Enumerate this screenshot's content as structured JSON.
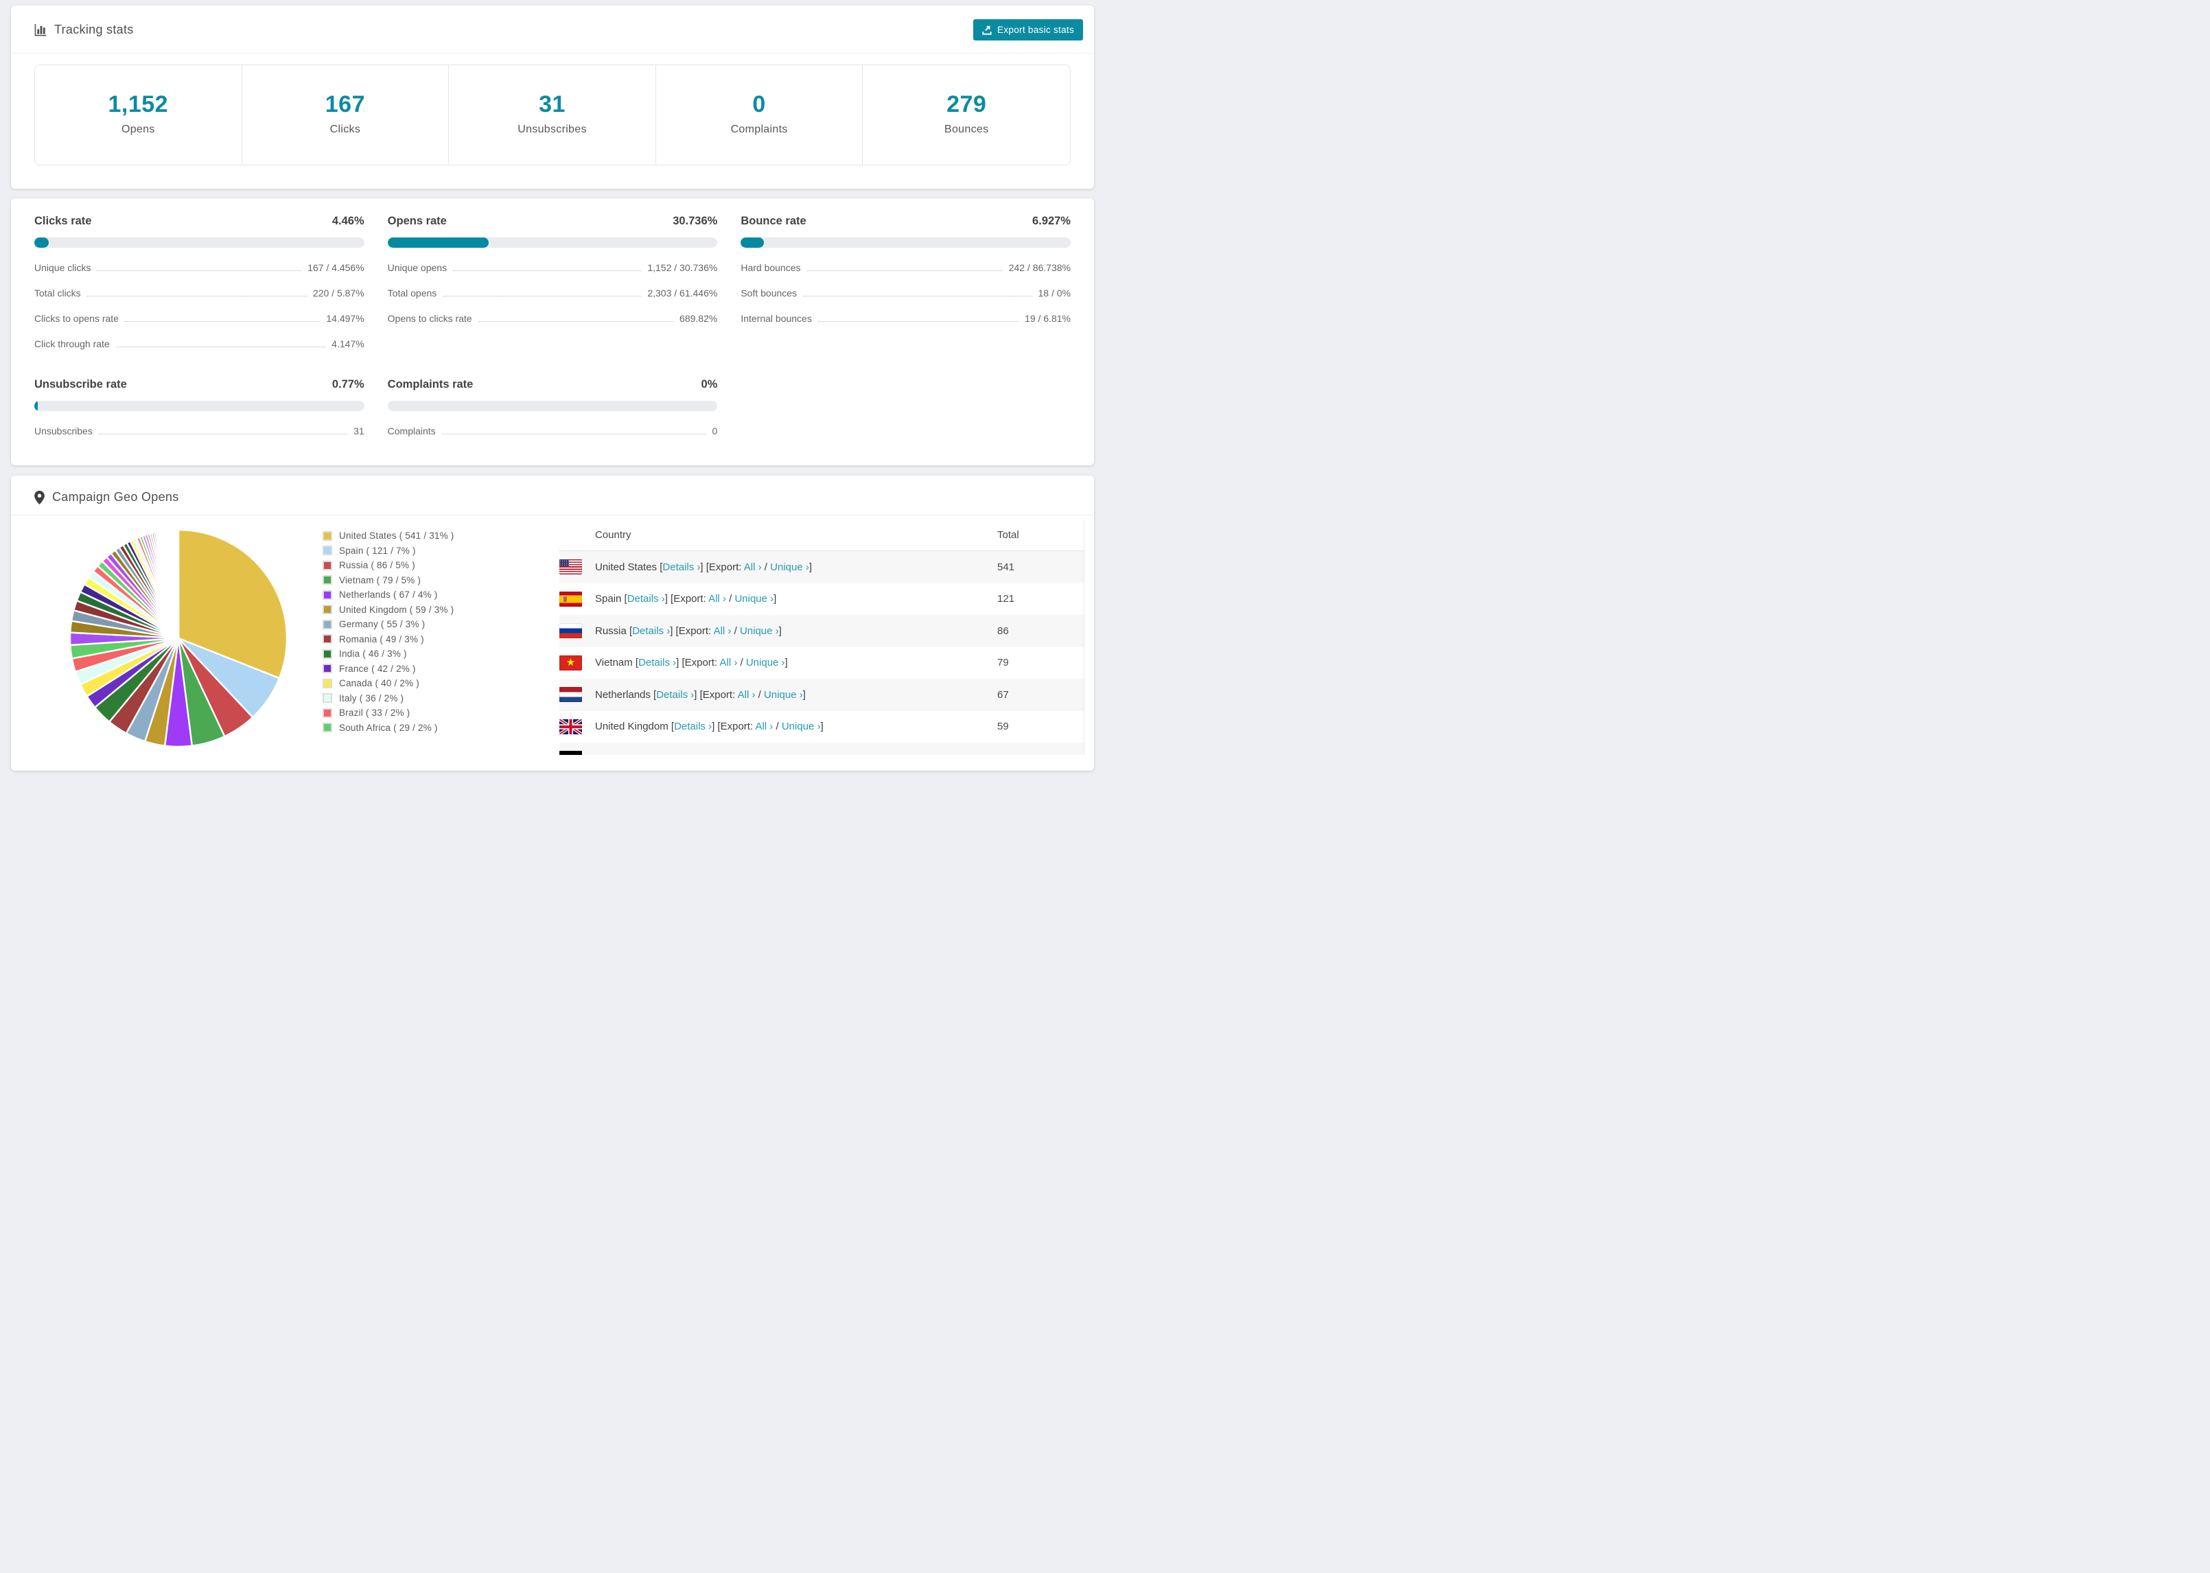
{
  "colors": {
    "accent": "#058aa2",
    "link": "#279bb0",
    "card_bg": "#ffffff",
    "page_bg": "#edeff2"
  },
  "tracking": {
    "title": "Tracking stats",
    "export_button": "Export basic stats",
    "stats": [
      {
        "value": "1,152",
        "label": "Opens"
      },
      {
        "value": "167",
        "label": "Clicks"
      },
      {
        "value": "31",
        "label": "Unsubscribes"
      },
      {
        "value": "0",
        "label": "Complaints"
      },
      {
        "value": "279",
        "label": "Bounces"
      }
    ]
  },
  "rates": {
    "blocks": [
      {
        "title": "Clicks rate",
        "value": "4.46%",
        "percent": 4.46,
        "row_group": 1,
        "rows": [
          {
            "label": "Unique clicks",
            "value": "167 / 4.456%"
          },
          {
            "label": "Total clicks",
            "value": "220 / 5.87%"
          },
          {
            "label": "Clicks to opens rate",
            "value": "14.497%"
          },
          {
            "label": "Click through rate",
            "value": "4.147%"
          }
        ]
      },
      {
        "title": "Opens rate",
        "value": "30.736%",
        "percent": 30.736,
        "row_group": 1,
        "rows": [
          {
            "label": "Unique opens",
            "value": "1,152 / 30.736%"
          },
          {
            "label": "Total opens",
            "value": "2,303 / 61.446%"
          },
          {
            "label": "Opens to clicks rate",
            "value": "689.82%"
          }
        ]
      },
      {
        "title": "Bounce rate",
        "value": "6.927%",
        "percent": 6.927,
        "row_group": 1,
        "rows": [
          {
            "label": "Hard bounces",
            "value": "242 / 86.738%"
          },
          {
            "label": "Soft bounces",
            "value": "18 / 0%"
          },
          {
            "label": "Internal bounces",
            "value": "19 / 6.81%"
          }
        ]
      },
      {
        "title": "Unsubscribe rate",
        "value": "0.77%",
        "percent": 0.77,
        "row_group": 2,
        "rows": [
          {
            "label": "Unsubscribes",
            "value": "31"
          }
        ]
      },
      {
        "title": "Complaints rate",
        "value": "0%",
        "percent": 0,
        "row_group": 2,
        "rows": [
          {
            "label": "Complaints",
            "value": "0"
          }
        ]
      }
    ]
  },
  "geo": {
    "title": "Campaign Geo Opens",
    "table": {
      "headers": [
        "Country",
        "Total"
      ],
      "link_labels": {
        "details": "Details ›",
        "export_prefix": "[Export:",
        "all": "All ›",
        "slash": "/",
        "unique": "Unique ›"
      },
      "rows": [
        {
          "country": "United States",
          "flag": "us",
          "total": "541"
        },
        {
          "country": "Spain",
          "flag": "es",
          "total": "121"
        },
        {
          "country": "Russia",
          "flag": "ru",
          "total": "86"
        },
        {
          "country": "Vietnam",
          "flag": "vn",
          "total": "79"
        },
        {
          "country": "Netherlands",
          "flag": "nl",
          "total": "67"
        },
        {
          "country": "United Kingdom",
          "flag": "gb",
          "total": "59"
        }
      ],
      "partial_row": {
        "flag": "de"
      }
    }
  },
  "chart_data": {
    "type": "pie",
    "title": "Campaign Geo Opens",
    "legend_position": "right",
    "start_angle_deg": -90,
    "direction": "clockwise",
    "items": [
      {
        "name": "United States",
        "value": 541,
        "percent": 31,
        "color": "#e3c149"
      },
      {
        "name": "Spain",
        "value": 121,
        "percent": 7,
        "color": "#aed5f4"
      },
      {
        "name": "Russia",
        "value": 86,
        "percent": 5,
        "color": "#ca4a4e"
      },
      {
        "name": "Vietnam",
        "value": 79,
        "percent": 5,
        "color": "#4aa952"
      },
      {
        "name": "Netherlands",
        "value": 67,
        "percent": 4,
        "color": "#9d3bf7"
      },
      {
        "name": "United Kingdom",
        "value": 59,
        "percent": 3,
        "color": "#bf9b2e"
      },
      {
        "name": "Germany",
        "value": 55,
        "percent": 3,
        "color": "#8cadc8"
      },
      {
        "name": "Romania",
        "value": 49,
        "percent": 3,
        "color": "#a03f3d"
      },
      {
        "name": "India",
        "value": 46,
        "percent": 3,
        "color": "#2e7d36"
      },
      {
        "name": "France",
        "value": 42,
        "percent": 2,
        "color": "#6b2fc4"
      },
      {
        "name": "Canada",
        "value": 40,
        "percent": 2,
        "color": "#fde94e"
      },
      {
        "name": "Italy",
        "value": 36,
        "percent": 2,
        "color": "#ddfcf8"
      },
      {
        "name": "Brazil",
        "value": 33,
        "percent": 2,
        "color": "#f56364"
      },
      {
        "name": "South Africa",
        "value": 29,
        "percent": 2,
        "color": "#5fd069"
      }
    ],
    "others": {
      "note": "remaining countries rendered as many thin unlabeled slices",
      "total_percent": 26,
      "slice_count": 60,
      "decay": 0.93,
      "colors": [
        "#a54ff2",
        "#9c7f20",
        "#8099ae",
        "#8e3434",
        "#276f38",
        "#45258e",
        "#fbfb55",
        "#defcf7",
        "#fb6a6a",
        "#68d271",
        "#de55de"
      ]
    }
  }
}
